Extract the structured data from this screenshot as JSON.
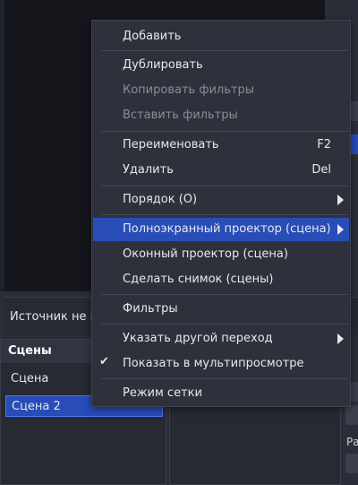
{
  "source_bar": {
    "text": "Источник не вы"
  },
  "scenes": {
    "title": "Сцены",
    "items": [
      "Сцена",
      "Сцена 2"
    ]
  },
  "mixer": {
    "label": "Ра"
  },
  "right_strip": {
    "mark": "М"
  },
  "context_menu": {
    "items": [
      {
        "label": "Добавить",
        "enabled": true
      },
      {
        "label": "Дублировать",
        "enabled": true
      },
      {
        "label": "Копировать фильтры",
        "enabled": false
      },
      {
        "label": "Вставить фильтры",
        "enabled": false
      },
      {
        "label": "Переименовать",
        "shortcut": "F2",
        "enabled": true
      },
      {
        "label": "Удалить",
        "shortcut": "Del",
        "enabled": true
      },
      {
        "label": "Порядок (O)",
        "submenu": true,
        "enabled": true
      },
      {
        "label": "Полноэкранный проектор (сцена)",
        "submenu": true,
        "highlighted": true,
        "enabled": true
      },
      {
        "label": "Оконный проектор (сцена)",
        "enabled": true
      },
      {
        "label": "Сделать снимок (сцены)",
        "enabled": true
      },
      {
        "label": "Фильтры",
        "enabled": true
      },
      {
        "label": "Указать другой переход",
        "submenu": true,
        "enabled": true
      },
      {
        "label": "Показать в мультипросмотре",
        "checked": true,
        "enabled": true
      },
      {
        "label": "Режим сетки",
        "enabled": true
      }
    ]
  },
  "colors": {
    "accent": "#284cb8",
    "menu_bg": "#2e313c",
    "panel_bg": "#272a33"
  }
}
